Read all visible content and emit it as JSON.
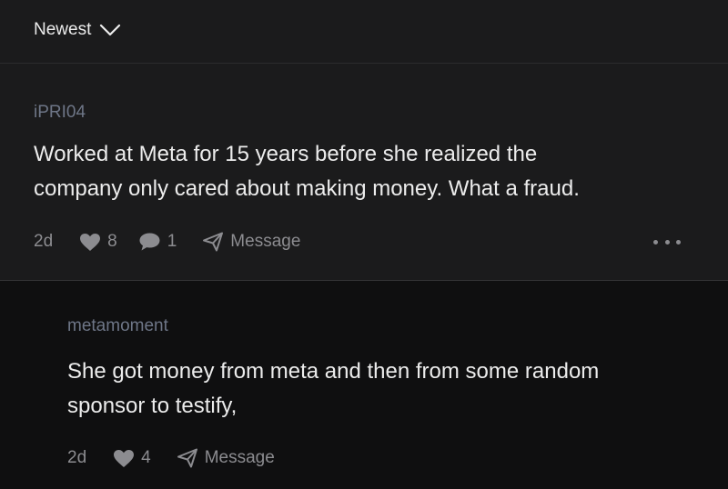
{
  "sort": {
    "label": "Newest",
    "chevron_icon": "chevron-down-icon"
  },
  "comments": [
    {
      "username": "iPRI04",
      "text_lines": [
        "Worked at Meta for 15 years before she realized the",
        "company only cared about making money. What a fraud."
      ],
      "age": "2d",
      "likes": "8",
      "replies": "1",
      "message_label": "Message",
      "more_icon": "more-options-icon"
    },
    {
      "username": "metamoment",
      "text_lines": [
        "She got money from meta and then from some random",
        "sponsor to testify,"
      ],
      "age": "2d",
      "likes": "4",
      "message_label": "Message"
    }
  ],
  "colors": {
    "background": "#0f0f10",
    "card": "#1b1b1c",
    "username": "#6e7687",
    "text": "#ececec",
    "meta": "#8c8c90"
  }
}
